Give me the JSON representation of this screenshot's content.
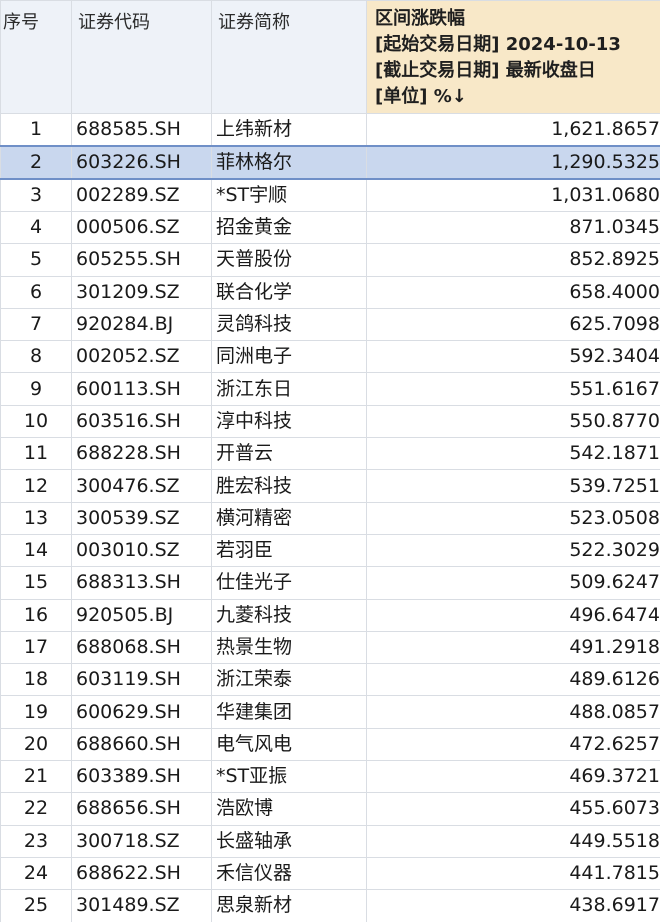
{
  "headers": {
    "seq": "序号",
    "code": "证券代码",
    "name": "证券简称",
    "range_lines": [
      "区间涨跌幅",
      "[起始交易日期] 2024-10-13",
      "[截止交易日期] 最新收盘日",
      "[单位] %↓"
    ]
  },
  "selected_row": 2,
  "colors": {
    "header_bg": "#eef2f8",
    "range_header_bg": "#f8e8c8",
    "selected_bg": "#c9d7ee",
    "grid_line": "#d9dde3"
  },
  "rows": [
    {
      "seq": "1",
      "code": "688585.SH",
      "name": "上纬新材",
      "value": "1,621.8657"
    },
    {
      "seq": "2",
      "code": "603226.SH",
      "name": "菲林格尔",
      "value": "1,290.5325"
    },
    {
      "seq": "3",
      "code": "002289.SZ",
      "name": "*ST宇顺",
      "value": "1,031.0680"
    },
    {
      "seq": "4",
      "code": "000506.SZ",
      "name": "招金黄金",
      "value": "871.0345"
    },
    {
      "seq": "5",
      "code": "605255.SH",
      "name": "天普股份",
      "value": "852.8925"
    },
    {
      "seq": "6",
      "code": "301209.SZ",
      "name": "联合化学",
      "value": "658.4000"
    },
    {
      "seq": "7",
      "code": "920284.BJ",
      "name": "灵鸽科技",
      "value": "625.7098"
    },
    {
      "seq": "8",
      "code": "002052.SZ",
      "name": "同洲电子",
      "value": "592.3404"
    },
    {
      "seq": "9",
      "code": "600113.SH",
      "name": "浙江东日",
      "value": "551.6167"
    },
    {
      "seq": "10",
      "code": "603516.SH",
      "name": "淳中科技",
      "value": "550.8770"
    },
    {
      "seq": "11",
      "code": "688228.SH",
      "name": "开普云",
      "value": "542.1871"
    },
    {
      "seq": "12",
      "code": "300476.SZ",
      "name": "胜宏科技",
      "value": "539.7251"
    },
    {
      "seq": "13",
      "code": "300539.SZ",
      "name": "横河精密",
      "value": "523.0508"
    },
    {
      "seq": "14",
      "code": "003010.SZ",
      "name": "若羽臣",
      "value": "522.3029"
    },
    {
      "seq": "15",
      "code": "688313.SH",
      "name": "仕佳光子",
      "value": "509.6247"
    },
    {
      "seq": "16",
      "code": "920505.BJ",
      "name": "九菱科技",
      "value": "496.6474"
    },
    {
      "seq": "17",
      "code": "688068.SH",
      "name": "热景生物",
      "value": "491.2918"
    },
    {
      "seq": "18",
      "code": "603119.SH",
      "name": "浙江荣泰",
      "value": "489.6126"
    },
    {
      "seq": "19",
      "code": "600629.SH",
      "name": "华建集团",
      "value": "488.0857"
    },
    {
      "seq": "20",
      "code": "688660.SH",
      "name": "电气风电",
      "value": "472.6257"
    },
    {
      "seq": "21",
      "code": "603389.SH",
      "name": "*ST亚振",
      "value": "469.3721"
    },
    {
      "seq": "22",
      "code": "688656.SH",
      "name": "浩欧博",
      "value": "455.6073"
    },
    {
      "seq": "23",
      "code": "300718.SZ",
      "name": "长盛轴承",
      "value": "449.5518"
    },
    {
      "seq": "24",
      "code": "688622.SH",
      "name": "禾信仪器",
      "value": "441.7815"
    },
    {
      "seq": "25",
      "code": "301489.SZ",
      "name": "思泉新材",
      "value": "438.6917"
    }
  ]
}
